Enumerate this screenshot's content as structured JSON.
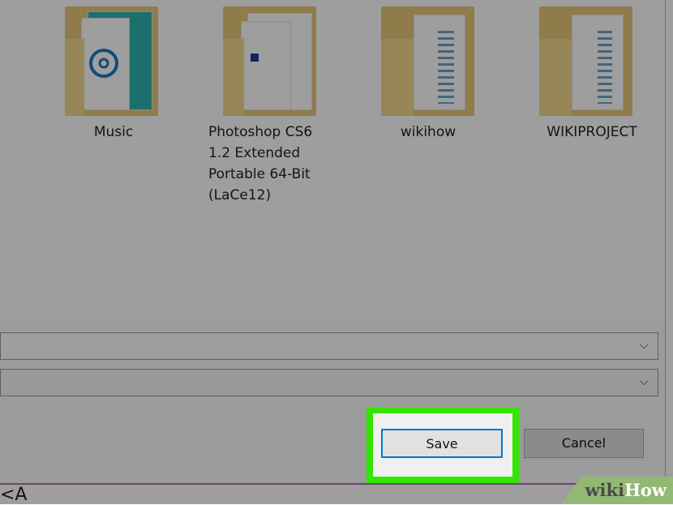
{
  "folders": [
    {
      "label": "Music"
    },
    {
      "label": "Photoshop CS6 1.2 Extended Portable 64-Bit (LaCe12)"
    },
    {
      "label": "wikihow"
    },
    {
      "label": "WIKIPROJECT"
    }
  ],
  "fields": {
    "filename_value": "",
    "filetype_value": ""
  },
  "buttons": {
    "save": "Save",
    "cancel": "Cancel"
  },
  "caption": "<A",
  "watermark": {
    "part1": "wiki",
    "part2": "How"
  },
  "colors": {
    "highlight": "#33e600",
    "save_border": "#0078d7",
    "folder": "#e9c97a"
  }
}
